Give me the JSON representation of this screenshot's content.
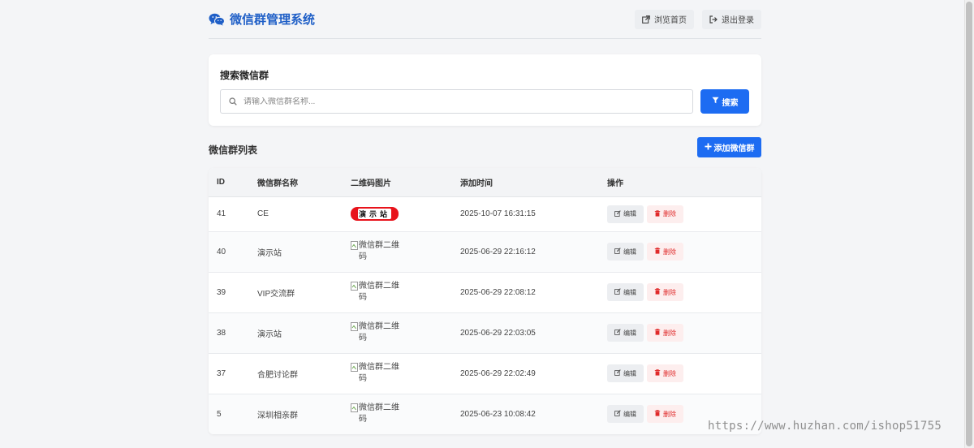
{
  "header": {
    "title": "微信群管理系统",
    "browse_home_label": "浏览首页",
    "logout_label": "退出登录"
  },
  "search": {
    "title": "搜索微信群",
    "placeholder": "请输入微信群名称...",
    "value": "",
    "button_label": "搜索"
  },
  "list": {
    "title": "微信群列表",
    "add_button_label": "添加微信群",
    "columns": [
      "ID",
      "微信群名称",
      "二维码图片",
      "添加时间",
      "操作"
    ],
    "rows": [
      {
        "id": "41",
        "name": "CE",
        "qr": "演示站",
        "qr_type": "image",
        "time": "2025-10-07 16:31:15"
      },
      {
        "id": "40",
        "name": "演示站",
        "qr": "微信群二维码",
        "qr_type": "broken",
        "time": "2025-06-29 22:16:12"
      },
      {
        "id": "39",
        "name": "VIP交流群",
        "qr": "微信群二维码",
        "qr_type": "broken",
        "time": "2025-06-29 22:08:12"
      },
      {
        "id": "38",
        "name": "演示站",
        "qr": "微信群二维码",
        "qr_type": "broken",
        "time": "2025-06-29 22:03:05"
      },
      {
        "id": "37",
        "name": "合肥讨论群",
        "qr": "微信群二维码",
        "qr_type": "broken",
        "time": "2025-06-29 22:02:49"
      },
      {
        "id": "5",
        "name": "深圳相亲群",
        "qr": "微信群二维码",
        "qr_type": "broken",
        "time": "2025-06-23 10:08:42"
      }
    ],
    "edit_label": "编辑",
    "delete_label": "删除"
  },
  "watermark": "https://www.huzhan.com/ishop51755",
  "colors": {
    "primary": "#1d6cf2",
    "brand": "#1f5fc7",
    "danger": "#e02a2a",
    "background": "#f4f5f7"
  },
  "icons": {
    "brand": "wechat-icon",
    "browse": "external-link-icon",
    "logout": "sign-out-icon",
    "search_field": "search-icon",
    "search_button": "filter-icon",
    "add": "plus-icon",
    "edit": "edit-icon",
    "delete": "trash-icon",
    "broken_image": "broken-image-icon"
  }
}
